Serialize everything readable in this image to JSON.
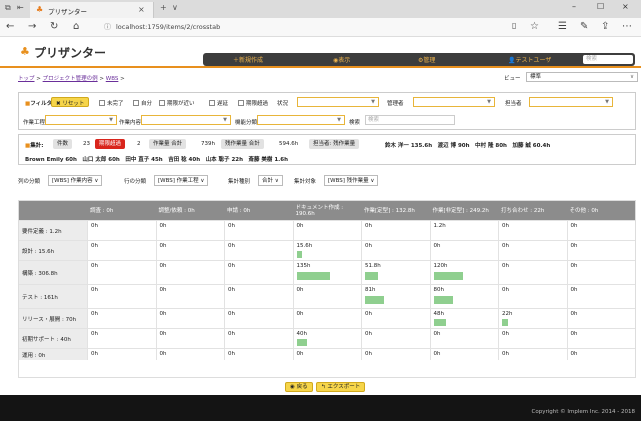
{
  "browser": {
    "tab_title": "プリザンター",
    "url": "localhost:1759/items/2/crosstab"
  },
  "app": {
    "logo": "プリザンター",
    "nav": [
      "新規作成",
      "表示",
      "管理",
      "テストユーザ"
    ],
    "search_placeholder": "検索"
  },
  "breadcrumb": {
    "items": [
      "トップ",
      "プロジェクト管理の例",
      "WBS"
    ],
    "sep": ">"
  },
  "view": {
    "label": "ビュー",
    "value": "標準"
  },
  "filter": {
    "label": "フィルタ:",
    "reset": "リセット",
    "checks": [
      "未完了",
      "自分",
      "期限が近い",
      "遅延",
      "期限超過"
    ],
    "status_label": "状況",
    "manager_label": "管理者",
    "owner_label": "担当者",
    "process_label": "作業工程",
    "content_label": "作業内容",
    "func_label": "機能分類",
    "search_label": "検索",
    "search_placeholder": "検索"
  },
  "summary": {
    "label": "集計:",
    "count_label": "件数",
    "count_value": "23",
    "overdue_label": "期限超過",
    "overdue_value": "2",
    "work_total_label": "作業量 合計",
    "work_total_value": "739h",
    "remaining_label": "残作業量 合計",
    "remaining_value": "594.6h",
    "owner_label": "担当者: 残作業量",
    "owner_line1": "鈴木 洋一 135.6h　渡辺 博 90h　中村 隆 80h　加藤 誠 60.4h",
    "owner_line2": "Brown Emily 60h　山口 太郎 60h　田中 直子 45h　吉田 稔 40h　山本 聡子 22h　斎藤 美樹 1.6h"
  },
  "axis": {
    "col_label": "列の分類",
    "col_value": "[WBS] 作業内容",
    "row_label": "行の分類",
    "row_value": "[WBS] 作業工程",
    "agg_label": "集計種別",
    "agg_value": "合計",
    "target_label": "集計対象",
    "target_value": "[WBS] 残作業量"
  },
  "grid": {
    "columns": [
      "調査 : 0h",
      "調整/依頼 : 0h",
      "申請 : 0h",
      "ドキュメント作成 : 190.6h",
      "作業[定型] : 132.8h",
      "作業[非定型] : 249.2h",
      "打ち合わせ : 22h",
      "その他 : 0h"
    ],
    "rows": [
      {
        "label": "要件定義 : 1.2h",
        "values": [
          "0h",
          "0h",
          "0h",
          "0h",
          "0h",
          "1.2h",
          "0h",
          "0h"
        ],
        "fills": [
          0,
          0,
          0,
          0,
          0,
          0,
          0,
          0
        ]
      },
      {
        "label": "設計 : 15.6h",
        "values": [
          "0h",
          "0h",
          "0h",
          "15.6h",
          "0h",
          "0h",
          "0h",
          "0h"
        ],
        "fills": [
          0,
          0,
          0,
          0.06,
          0,
          0,
          0,
          0
        ]
      },
      {
        "label": "構築 : 306.8h",
        "values": [
          "0h",
          "0h",
          "0h",
          "135h",
          "51.8h",
          "120h",
          "0h",
          "0h"
        ],
        "fills": [
          0,
          0,
          0,
          0.52,
          0.2,
          0.47,
          0,
          0
        ]
      },
      {
        "label": "テスト : 161h",
        "values": [
          "0h",
          "0h",
          "0h",
          "0h",
          "81h",
          "80h",
          "0h",
          "0h"
        ],
        "fills": [
          0,
          0,
          0,
          0,
          0.31,
          0.31,
          0,
          0
        ]
      },
      {
        "label": "リリース・展開 : 70h",
        "values": [
          "0h",
          "0h",
          "0h",
          "0h",
          "0h",
          "48h",
          "22h",
          "0h"
        ],
        "fills": [
          0,
          0,
          0,
          0,
          0,
          0.19,
          0.09,
          0
        ]
      },
      {
        "label": "初期サポート : 40h",
        "values": [
          "0h",
          "0h",
          "0h",
          "40h",
          "0h",
          "0h",
          "0h",
          "0h"
        ],
        "fills": [
          0,
          0,
          0,
          0.16,
          0,
          0,
          0,
          0
        ]
      },
      {
        "label": "運用 : 0h",
        "values": [
          "0h",
          "0h",
          "0h",
          "0h",
          "0h",
          "0h",
          "0h",
          "0h"
        ],
        "fills": [
          0,
          0,
          0,
          0,
          0,
          0,
          0,
          0
        ]
      }
    ]
  },
  "buttons": {
    "back": "戻る",
    "export": "エクスポート"
  },
  "footer": {
    "copyright": "Copyright © Implem Inc. 2014 - 2018"
  },
  "colors": {
    "accent": "#e8901e",
    "bar": "#8fcf8f",
    "danger": "#d9251c"
  }
}
